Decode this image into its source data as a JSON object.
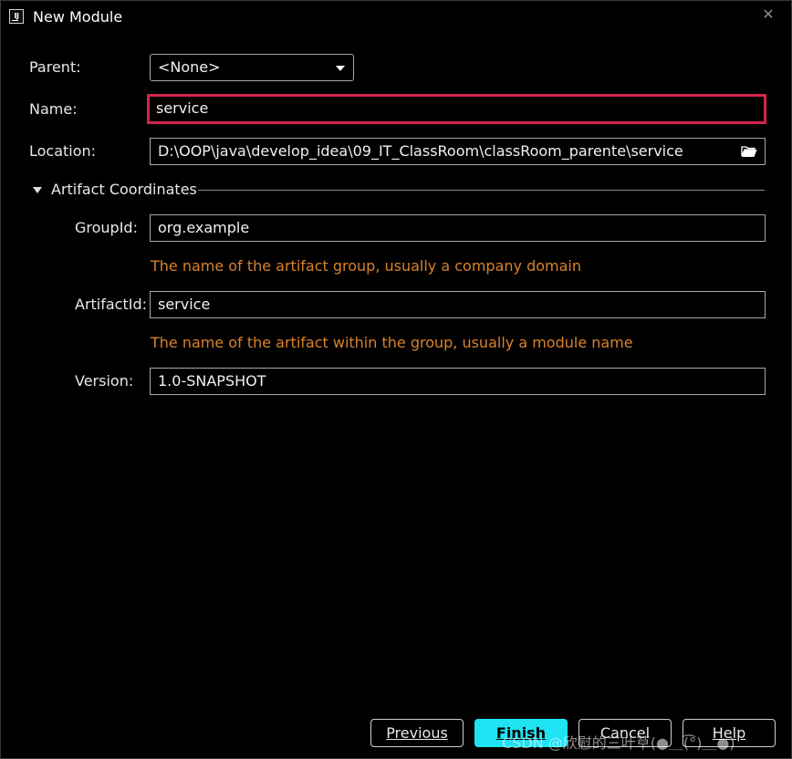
{
  "window": {
    "title": "New Module",
    "app_icon_text": "IJ"
  },
  "form": {
    "parent_label": "Parent:",
    "parent_value": "<None>",
    "name_label": "Name:",
    "name_value": "service",
    "location_label": "Location:",
    "location_value": "D:\\OOP\\java\\develop_idea\\09_IT_ClassRoom\\classRoom_parente\\service"
  },
  "artifact": {
    "section_title": "Artifact Coordinates",
    "groupid_label": "GroupId:",
    "groupid_value": "org.example",
    "groupid_hint": "The name of the artifact group, usually a company domain",
    "artifactid_label": "ArtifactId:",
    "artifactid_value": "service",
    "artifactid_hint": "The name of the artifact within the group, usually a module name",
    "version_label": "Version:",
    "version_value": "1.0-SNAPSHOT"
  },
  "buttons": {
    "previous": "Previous",
    "finish": "Finish",
    "cancel": "Cancel",
    "help": "Help"
  },
  "watermark": "CSDN @欣慰的三叶草(●＿(͡°)＿●)",
  "colors": {
    "focus_border": "#d6244a",
    "hint_text": "#d9822b",
    "primary_button": "#1ee3f2"
  },
  "icons": {
    "close": "close-icon",
    "dropdown": "chevron-down-icon",
    "folder": "folder-open-icon",
    "section_toggle": "triangle-down-icon"
  }
}
